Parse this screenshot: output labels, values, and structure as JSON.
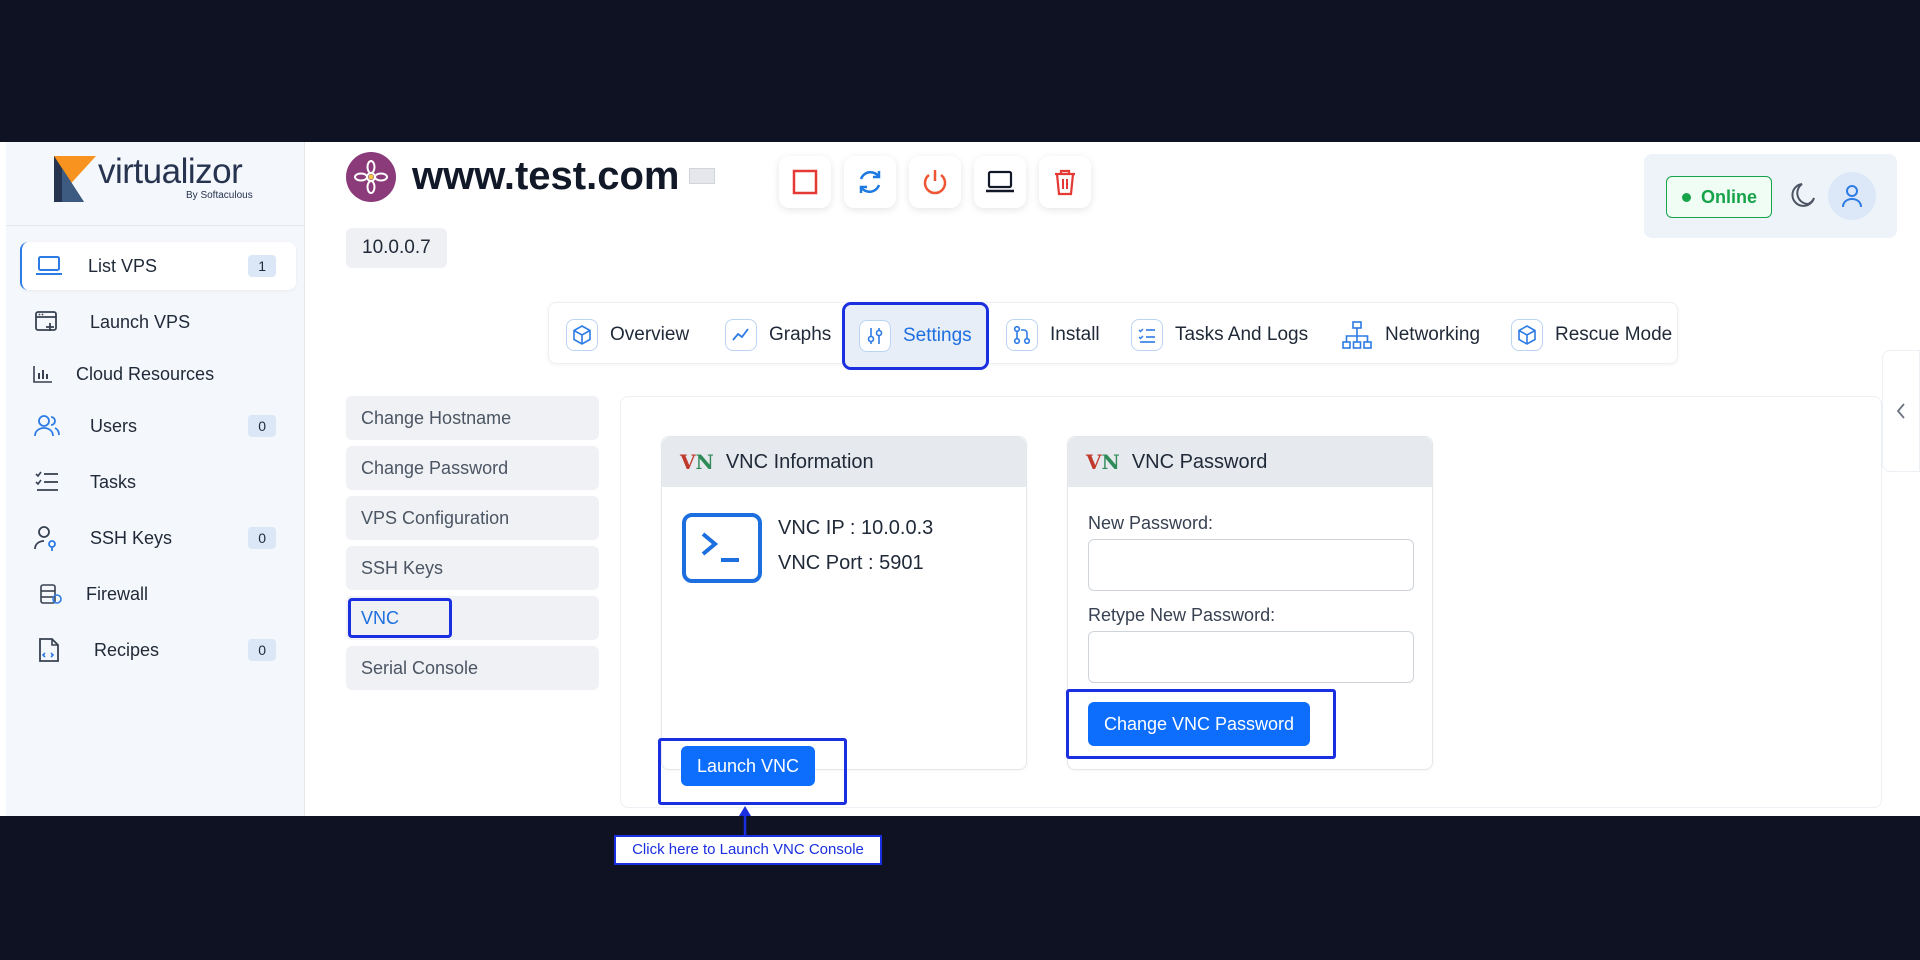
{
  "brand": {
    "name": "virtualizor",
    "sub": "By Softaculous"
  },
  "sidebar": {
    "items": [
      {
        "label": "List VPS",
        "badge": "1",
        "icon": "laptop-icon"
      },
      {
        "label": "Launch VPS",
        "badge": null,
        "icon": "launch-window-icon"
      },
      {
        "label": "Cloud Resources",
        "badge": null,
        "icon": "bar-chart-icon"
      },
      {
        "label": "Users",
        "badge": "0",
        "icon": "users-icon"
      },
      {
        "label": "Tasks",
        "badge": null,
        "icon": "task-list-icon"
      },
      {
        "label": "SSH Keys",
        "badge": "0",
        "icon": "user-key-icon"
      },
      {
        "label": "Firewall",
        "badge": null,
        "icon": "firewall-icon"
      },
      {
        "label": "Recipes",
        "badge": "0",
        "icon": "recipe-file-icon"
      }
    ]
  },
  "header": {
    "title": "www.test.com",
    "ip": "10.0.0.7",
    "status": "Online",
    "actions": [
      "stop-icon",
      "restart-icon",
      "power-icon",
      "console-icon",
      "delete-icon"
    ]
  },
  "tabs": [
    {
      "label": "Overview",
      "icon": "cube-icon"
    },
    {
      "label": "Graphs",
      "icon": "line-graph-icon"
    },
    {
      "label": "Settings",
      "icon": "sliders-icon",
      "active": true
    },
    {
      "label": "Install",
      "icon": "git-icon"
    },
    {
      "label": "Tasks And Logs",
      "icon": "checklist-icon"
    },
    {
      "label": "Networking",
      "icon": "network-icon"
    },
    {
      "label": "Rescue Mode",
      "icon": "rescue-cube-icon"
    }
  ],
  "settings_menu": [
    {
      "label": "Change Hostname"
    },
    {
      "label": "Change Password"
    },
    {
      "label": "VPS Configuration"
    },
    {
      "label": "SSH Keys"
    },
    {
      "label": "VNC",
      "active": true
    },
    {
      "label": "Serial Console"
    }
  ],
  "vnc_info": {
    "title": "VNC Information",
    "ip_line": "VNC IP : 10.0.0.3",
    "port_line": "VNC Port : 5901",
    "launch_button": "Launch VNC",
    "callout": "Click here to Launch VNC Console"
  },
  "vnc_password": {
    "title": "VNC Password",
    "new_label": "New Password:",
    "retype_label": "Retype New Password:",
    "new_value": "",
    "retype_value": "",
    "submit_button": "Change VNC Password"
  },
  "colors": {
    "accent": "#0d6efd",
    "highlight": "#1a2fe0",
    "online": "#16a34a",
    "frame": "#0e1223"
  }
}
